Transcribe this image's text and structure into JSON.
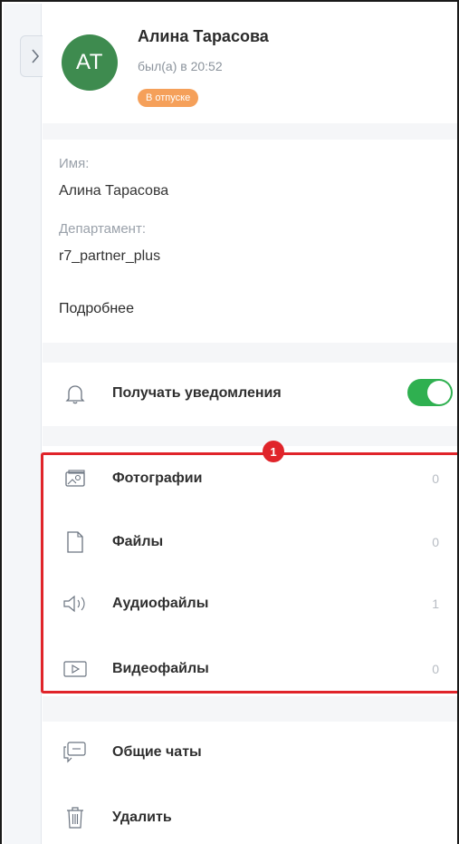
{
  "user": {
    "initials": "AT",
    "name": "Алина Тарасова",
    "last_seen": "был(а) в 20:52",
    "status": "В отпуске"
  },
  "details": {
    "name_label": "Имя:",
    "name_value": "Алина Тарасова",
    "department_label": "Департамент:",
    "department_value": "r7_partner_plus",
    "more_link": "Подробнее"
  },
  "notifications": {
    "label": "Получать уведомления",
    "enabled": true
  },
  "media": [
    {
      "label": "Фотографии",
      "count": "0",
      "icon": "photo-icon"
    },
    {
      "label": "Файлы",
      "count": "0",
      "icon": "file-icon"
    },
    {
      "label": "Аудиофайлы",
      "count": "1",
      "icon": "audio-icon"
    },
    {
      "label": "Видеофайлы",
      "count": "0",
      "icon": "video-icon"
    }
  ],
  "actions": [
    {
      "label": "Общие чаты",
      "icon": "chat-icon"
    },
    {
      "label": "Удалить",
      "icon": "trash-icon"
    }
  ],
  "annotation": {
    "marker": "1",
    "color": "#e0242a"
  },
  "colors": {
    "avatar": "#3e8b4f",
    "status_badge": "#f5a05a",
    "toggle_on": "#2fb050"
  }
}
